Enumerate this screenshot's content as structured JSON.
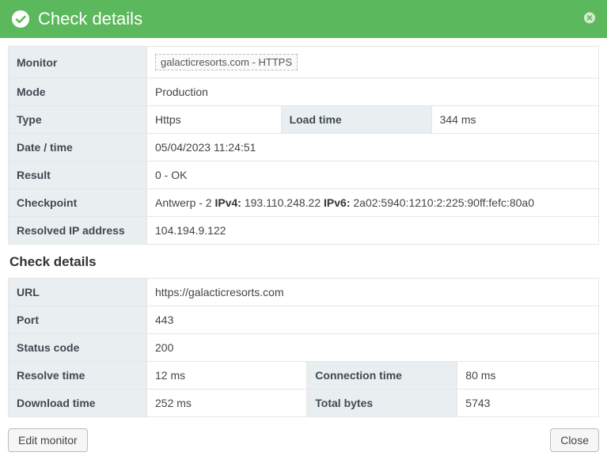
{
  "header": {
    "title": "Check details"
  },
  "top": {
    "monitor_label": "Monitor",
    "monitor_value": "galacticresorts.com - HTTPS",
    "mode_label": "Mode",
    "mode_value": "Production",
    "type_label": "Type",
    "type_value": "Https",
    "loadtime_label": "Load time",
    "loadtime_value": "344 ms",
    "datetime_label": "Date / time",
    "datetime_value": "05/04/2023 11:24:51",
    "result_label": "Result",
    "result_value": "0 - OK",
    "checkpoint_label": "Checkpoint",
    "checkpoint_prefix": "Antwerp - 2 ",
    "checkpoint_ipv4_label": "IPv4:",
    "checkpoint_ipv4": " 193.110.248.22 ",
    "checkpoint_ipv6_label": "IPv6:",
    "checkpoint_ipv6": " 2a02:5940:1210:2:225:90ff:fefc:80a0",
    "resolvedip_label": "Resolved IP address",
    "resolvedip_value": "104.194.9.122"
  },
  "section_title": "Check details",
  "details": {
    "url_label": "URL",
    "url_value": "https://galacticresorts.com",
    "port_label": "Port",
    "port_value": "443",
    "status_label": "Status code",
    "status_value": "200",
    "resolve_label": "Resolve time",
    "resolve_value": "12 ms",
    "connect_label": "Connection time",
    "connect_value": "80 ms",
    "download_label": "Download time",
    "download_value": "252 ms",
    "totalbytes_label": "Total bytes",
    "totalbytes_value": "5743"
  },
  "footer": {
    "edit_label": "Edit monitor",
    "close_label": "Close"
  }
}
